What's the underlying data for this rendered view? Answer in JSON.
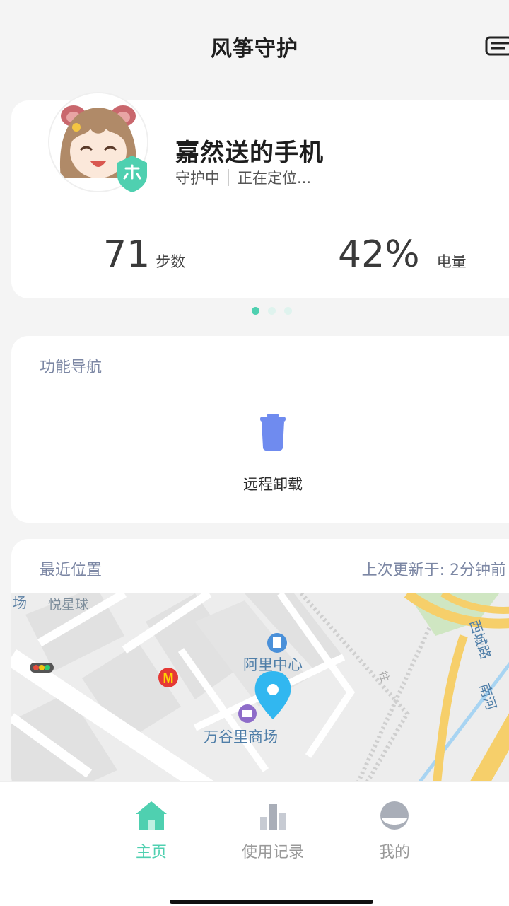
{
  "header": {
    "title": "风筝守护"
  },
  "device": {
    "name": "嘉然送的手机",
    "status": "守护中",
    "location_status": "正在定位...",
    "steps": {
      "value": "71",
      "unit": "步数"
    },
    "battery": {
      "value": "42%",
      "unit": "电量"
    },
    "carousel": {
      "pages": 3,
      "active": 0
    }
  },
  "nav": {
    "title": "功能导航",
    "items": [
      {
        "label": "远程卸载",
        "icon": "trash-icon"
      }
    ]
  },
  "location": {
    "title": "最近位置",
    "updated": "上次更新于: 2分钟前",
    "map_labels": {
      "l1": "场",
      "l2": "悦星球",
      "l3": "阿里中心",
      "l4": "万谷里商场",
      "l5": "西城路",
      "l6": "南河",
      "l7": "往"
    }
  },
  "tabbar": {
    "items": [
      {
        "label": "主页",
        "icon": "home-icon",
        "active": true
      },
      {
        "label": "使用记录",
        "icon": "bar-chart-icon",
        "active": false
      },
      {
        "label": "我的",
        "icon": "profile-icon",
        "active": false
      }
    ]
  },
  "colors": {
    "accent": "#4fd0b0",
    "section_title": "#7c87a4",
    "trash_icon": "#6f8bef",
    "map_pin": "#31b7f0"
  }
}
